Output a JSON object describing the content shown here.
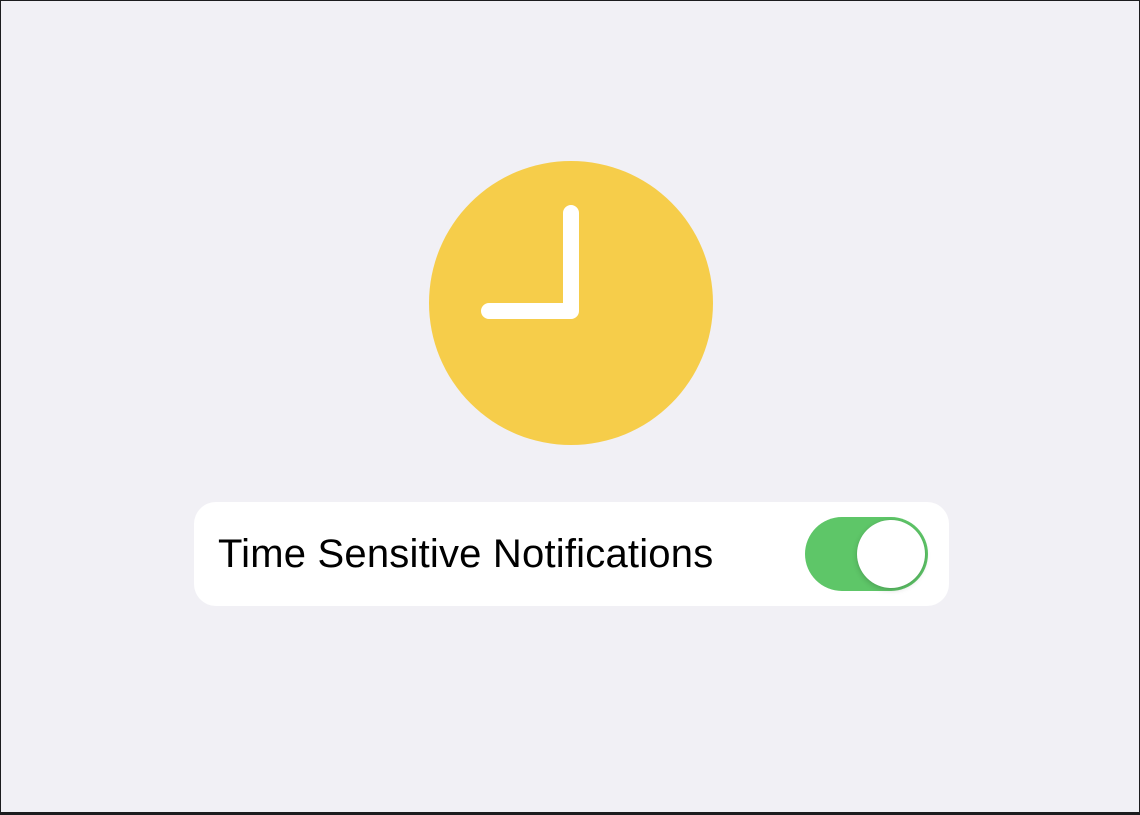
{
  "hero": {
    "icon": "clock-icon",
    "icon_color": "#f6cd4a",
    "hand_color": "#ffffff"
  },
  "setting": {
    "label": "Time Sensitive Notifications",
    "toggle_on": true,
    "toggle_color": "#5ec668"
  }
}
